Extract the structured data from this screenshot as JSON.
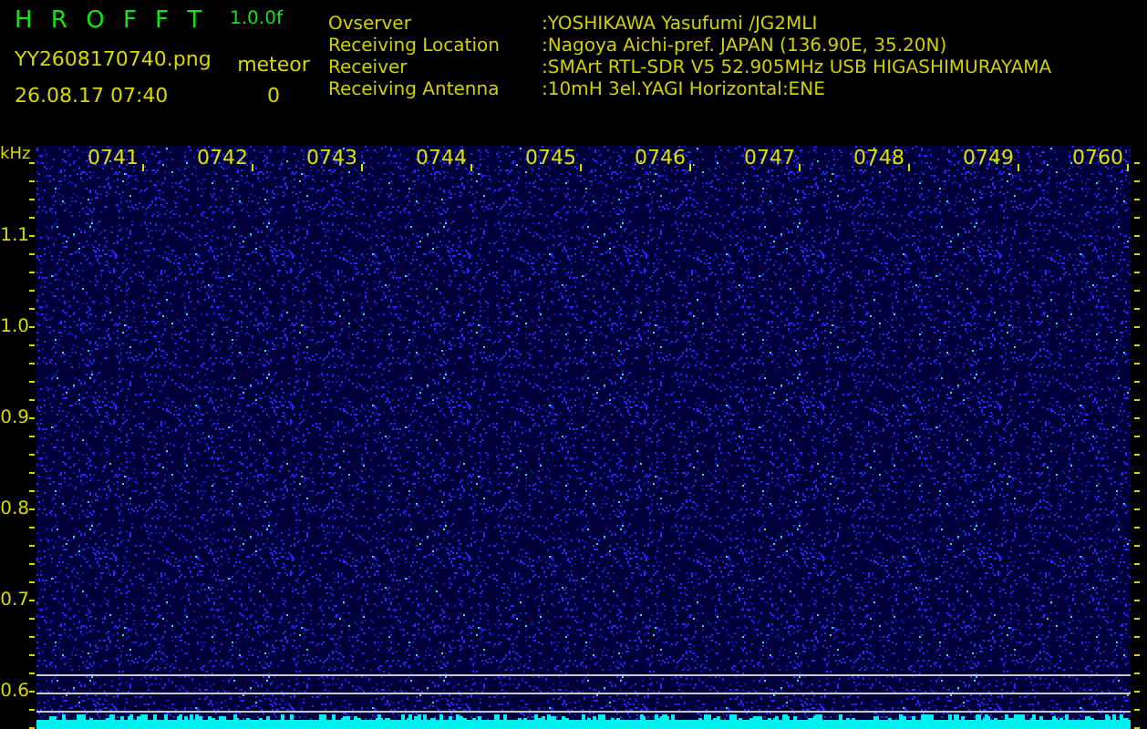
{
  "header": {
    "title": "H R O F F T",
    "version": "1.0.0f",
    "filename": "YY2608170740.png",
    "timestamp": "26.08.17 07:40",
    "counter_label": "meteor",
    "counter_value": "0"
  },
  "info": [
    {
      "label": "Ovserver",
      "value": ":YOSHIKAWA Yasufumi /JG2MLI"
    },
    {
      "label": "Receiving Location",
      "value": ":Nagoya Aichi-pref. JAPAN (136.90E, 35.20N)"
    },
    {
      "label": "Receiver",
      "value": ":SMArt RTL-SDR V5 52.905MHz USB HIGASHIMURAYAMA"
    },
    {
      "label": "Receiving Antenna",
      "value": ":10mH 3el.YAGI Horizontal:ENE"
    }
  ],
  "spectrogram": {
    "unit": "kHz",
    "y_labels": [
      "1.1",
      "1.0",
      "0.9",
      "0.8",
      "0.7",
      "0.6"
    ],
    "time_labels": [
      "0741",
      "0742",
      "0743",
      "0744",
      "0745",
      "0746",
      "0747",
      "0748",
      "0749",
      "0760"
    ]
  }
}
